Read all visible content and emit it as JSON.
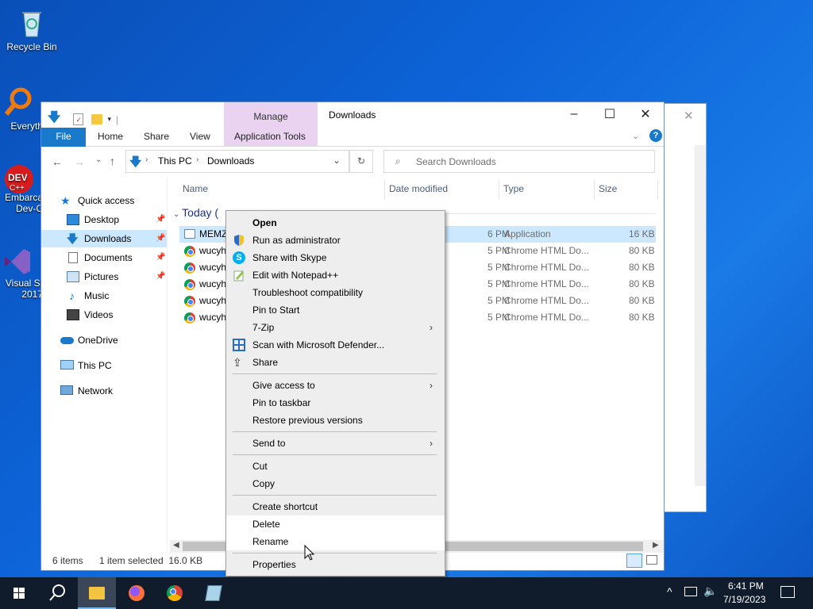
{
  "desktop": {
    "icons": [
      {
        "label": "Recycle Bin"
      },
      {
        "label": "Everyth"
      },
      {
        "label": "Embarca\nDev-C"
      },
      {
        "label": "Visual St\n2017"
      }
    ]
  },
  "explorer": {
    "title": "Downloads",
    "context_tab_group": "Manage",
    "ribbon_tabs": [
      "File",
      "Home",
      "Share",
      "View",
      "Application Tools"
    ],
    "breadcrumb": [
      "This PC",
      "Downloads"
    ],
    "search_placeholder": "Search Downloads",
    "nav": {
      "quick_access": "Quick access",
      "items": [
        {
          "label": "Desktop",
          "pinned": true
        },
        {
          "label": "Downloads",
          "pinned": true,
          "selected": true
        },
        {
          "label": "Documents",
          "pinned": true
        },
        {
          "label": "Pictures",
          "pinned": true
        },
        {
          "label": "Music",
          "pinned": false
        },
        {
          "label": "Videos",
          "pinned": false
        }
      ],
      "onedrive": "OneDrive",
      "this_pc": "This PC",
      "network": "Network"
    },
    "columns": [
      "Name",
      "Date modified",
      "Type",
      "Size"
    ],
    "group_header": "Today (",
    "files": [
      {
        "name": "MEMZ",
        "date": "6 PM",
        "type": "Application",
        "size": "16 KB",
        "selected": true
      },
      {
        "name": "wucyh",
        "date": "5 PM",
        "type": "Chrome HTML Do...",
        "size": "80 KB"
      },
      {
        "name": "wucyh",
        "date": "5 PM",
        "type": "Chrome HTML Do...",
        "size": "80 KB"
      },
      {
        "name": "wucyh",
        "date": "5 PM",
        "type": "Chrome HTML Do...",
        "size": "80 KB"
      },
      {
        "name": "wucyh",
        "date": "5 PM",
        "type": "Chrome HTML Do...",
        "size": "80 KB"
      },
      {
        "name": "wucyh",
        "date": "5 PM",
        "type": "Chrome HTML Do...",
        "size": "80 KB"
      }
    ],
    "status": {
      "count": "6 items",
      "selection": "1 item selected  16.0 KB"
    }
  },
  "context_menu": {
    "items": [
      "Open",
      "Run as administrator",
      "Share with Skype",
      "Edit with Notepad++",
      "Troubleshoot compatibility",
      "Pin to Start",
      "7-Zip",
      "Scan with Microsoft Defender...",
      "Share",
      "Give access to",
      "Pin to taskbar",
      "Restore previous versions",
      "Send to",
      "Cut",
      "Copy",
      "Create shortcut",
      "Delete",
      "Rename",
      "Properties"
    ]
  },
  "taskbar": {
    "time": "6:41 PM",
    "date": "7/19/2023"
  },
  "colors": {
    "accent": "#1979ca",
    "selection": "#cce8ff",
    "manage_tab": "#e9d3f0"
  }
}
